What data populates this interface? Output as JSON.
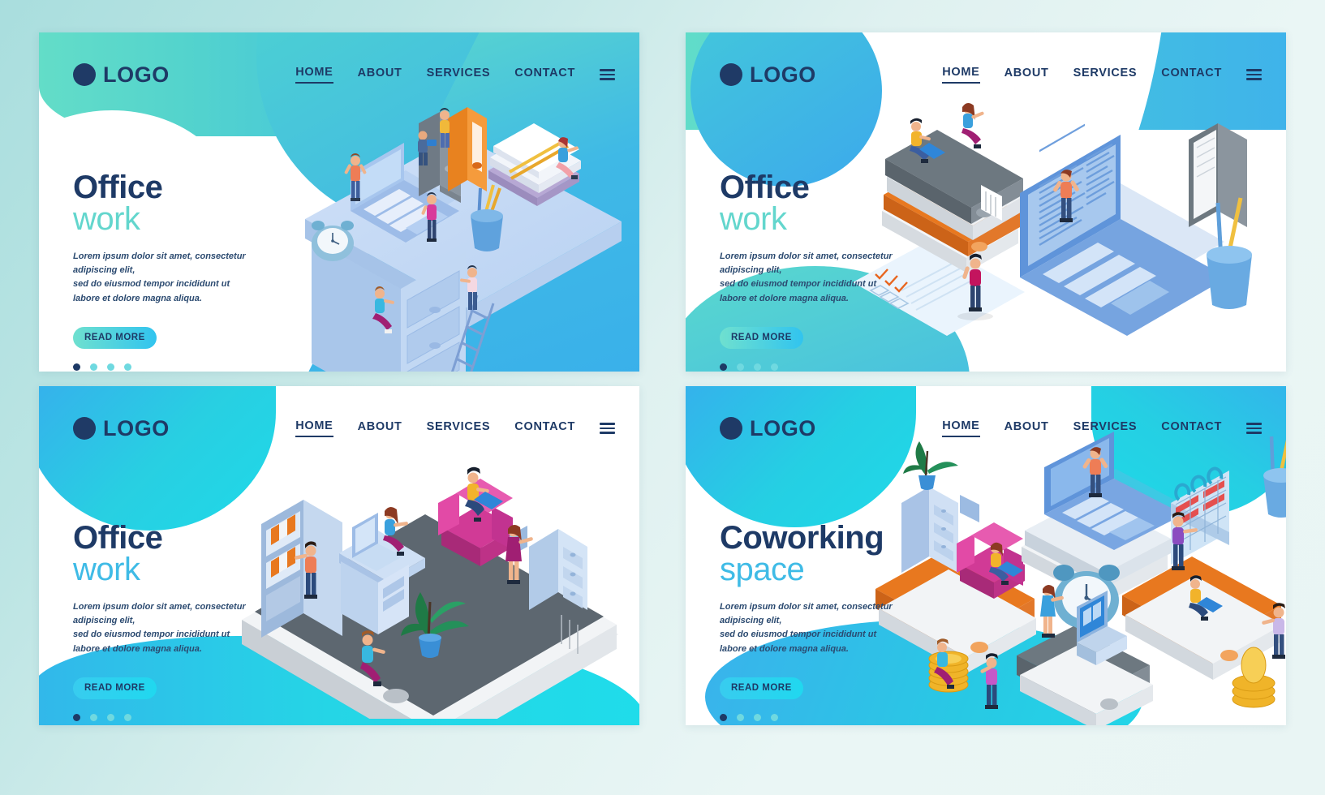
{
  "page": {
    "title": "Office work landing page templates set",
    "background_color": "#bde5e4",
    "card_count": 4
  },
  "brand": {
    "logo_text": "LOGO",
    "logo_color": "#1e3a66"
  },
  "nav": {
    "items": [
      "HOME",
      "ABOUT",
      "SERVICES",
      "CONTACT"
    ],
    "active": "HOME",
    "menu_icon": "hamburger-icon"
  },
  "common": {
    "body_text": "Lorem ipsum dolor sit amet, consectetur adipiscing elit, sed do eiusmod tempor incididunt ut labore et dolore magna aliqua.",
    "body_line1": "Lorem ipsum dolor sit amet, consectetur adipiscing elit,",
    "body_line2": "sed do eiusmod tempor incididunt ut",
    "body_line3": "labore et dolore magna aliqua.",
    "cta_label": "READ MORE",
    "pagination_dots": 4,
    "pagination_active_index": 0
  },
  "cards": [
    {
      "id": "card-1",
      "heading_line1": "Office",
      "heading_line2": "work",
      "accent_color": "#63d6cd",
      "heading_color": "#1e3a66",
      "header_style": "teal-to-blue-band-with-circle",
      "cta_gradient": [
        "#6fe0cf",
        "#31c4ef"
      ],
      "illustration": "isometric-desk-with-laptop-binders-books-clock-ladder"
    },
    {
      "id": "card-2",
      "heading_line1": "Office",
      "heading_line2": "work",
      "accent_color": "#63d6cd",
      "heading_color": "#1e3a66",
      "header_style": "full-width-teal-blue-band",
      "cta_gradient": [
        "#6fe0cf",
        "#31c4ef"
      ],
      "illustration": "isometric-laptop-document-binder-stack-checklist-pencil-cup"
    },
    {
      "id": "card-3",
      "heading_line1": "Office",
      "heading_line2": "work",
      "accent_color": "#3fbbe6",
      "heading_color": "#1e3a66",
      "header_style": "blue-cyan-blob-top-left",
      "cta_gradient": [
        "#38ccef",
        "#20d8ef"
      ],
      "illustration": "isometric-office-room-on-binder-with-shelf-sofa-desk-plant"
    },
    {
      "id": "card-4",
      "heading_line1": "Coworking",
      "heading_line2": "space",
      "accent_color": "#3fbbe6",
      "heading_color": "#1e3a66",
      "header_style": "blue-cyan-blobs-both-corners",
      "cta_gradient": [
        "#38ccef",
        "#20d8ef"
      ],
      "illustration": "isometric-coworking-binders-laptop-clock-calendar-coins"
    }
  ],
  "palette": {
    "navy": "#1e3a66",
    "teal": "#63d6cd",
    "cyan": "#20d8ef",
    "sky": "#3fb3ea",
    "orange": "#e8781f",
    "magenta": "#c32aa3",
    "gray": "#6b7780",
    "card_white": "#ffffff"
  }
}
